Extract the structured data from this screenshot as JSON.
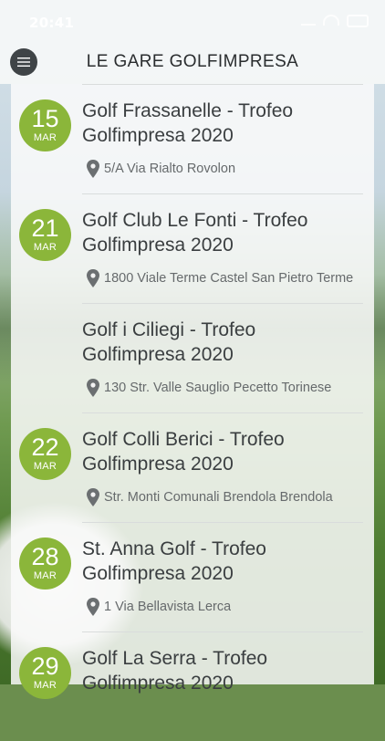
{
  "status_bar": {
    "time": "20:41"
  },
  "header": {
    "title": "LE GARE GOLFIMPRESA"
  },
  "colors": {
    "badge": "#8bb63a",
    "header_bg": "#f5f7f8",
    "menu_button": "#3f4447"
  },
  "events": [
    {
      "day": "15",
      "month": "MAR",
      "title": "Golf Frassanelle - Trofeo Golfimpresa 2020",
      "address": "5/A Via Rialto Rovolon"
    },
    {
      "day": "21",
      "month": "MAR",
      "title": "Golf Club Le Fonti - Trofeo Golfimpresa 2020",
      "address": "1800 Viale Terme Castel San Pietro Terme"
    },
    {
      "day": "",
      "month": "",
      "title": "Golf i Ciliegi - Trofeo Golfimpresa 2020",
      "address": "130 Str. Valle Sauglio Pecetto Torinese"
    },
    {
      "day": "22",
      "month": "MAR",
      "title": "Golf Colli Berici - Trofeo Golfimpresa 2020",
      "address": "Str. Monti Comunali Brendola Brendola"
    },
    {
      "day": "28",
      "month": "MAR",
      "title": "St. Anna Golf - Trofeo Golfimpresa 2020",
      "address": "1 Via Bellavista Lerca"
    },
    {
      "day": "29",
      "month": "MAR",
      "title": "Golf La Serra - Trofeo Golfimpresa 2020",
      "address": ""
    }
  ],
  "icons": {
    "menu": "hamburger-menu-icon",
    "location": "location-pin-icon"
  }
}
